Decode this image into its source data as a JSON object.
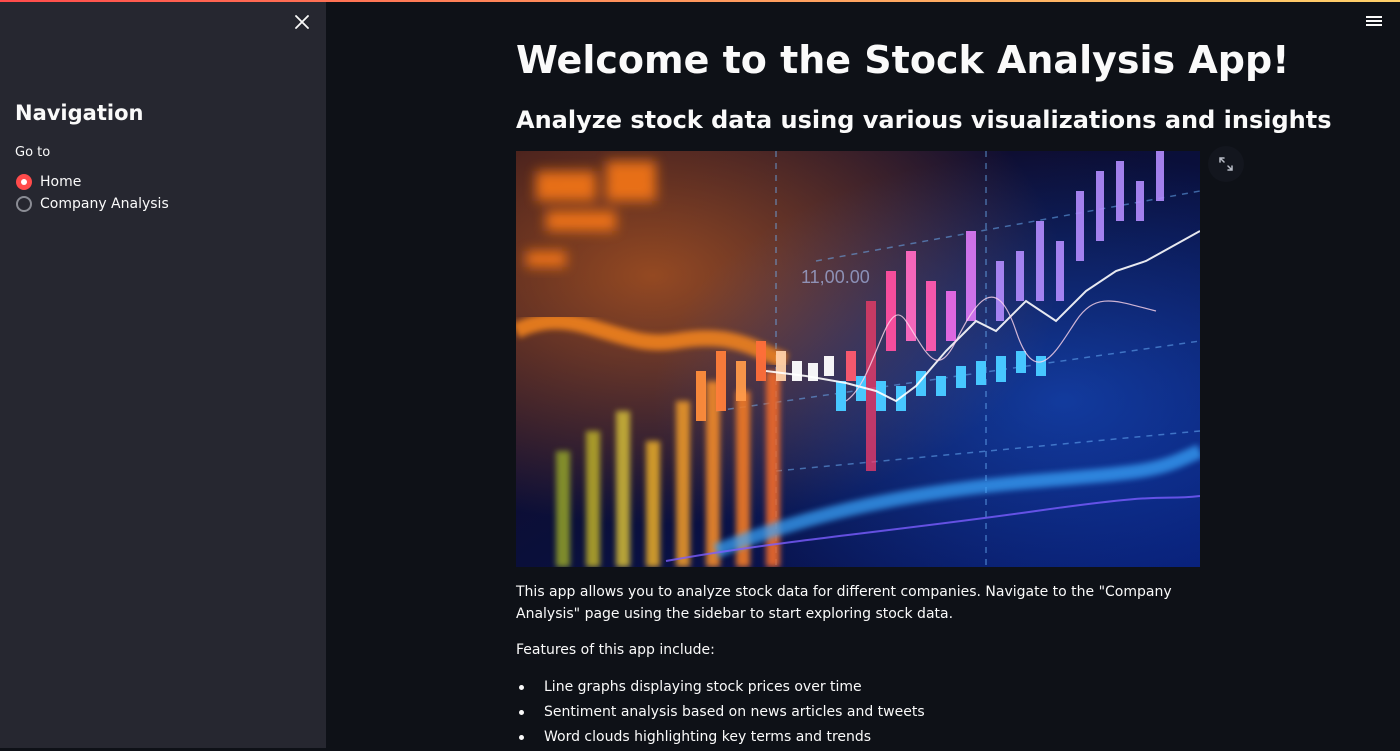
{
  "sidebar": {
    "title": "Navigation",
    "radio_label": "Go to",
    "options": [
      {
        "label": "Home",
        "selected": true
      },
      {
        "label": "Company Analysis",
        "selected": false
      }
    ]
  },
  "icons": {
    "close": "close-icon",
    "menu": "hamburger-menu-icon",
    "expand": "expand-icon"
  },
  "main": {
    "title": "Welcome to the Stock Analysis App!",
    "subtitle": "Analyze stock data using various visualizations and insights",
    "image": {
      "description": "stock chart hero image",
      "chart_value_text": "11,00.00"
    },
    "intro": "This app allows you to analyze stock data for different companies. Navigate to the \"Company Analysis\" page using the sidebar to start exploring stock data.",
    "features_intro": "Features of this app include:",
    "features": [
      "Line graphs displaying stock prices over time",
      "Sentiment analysis based on news articles and tweets",
      "Word clouds highlighting key terms and trends"
    ]
  },
  "colors": {
    "accent": "#ff4b4b",
    "background": "#0e1117",
    "sidebar_bg": "#262730",
    "text": "#fafafa"
  }
}
